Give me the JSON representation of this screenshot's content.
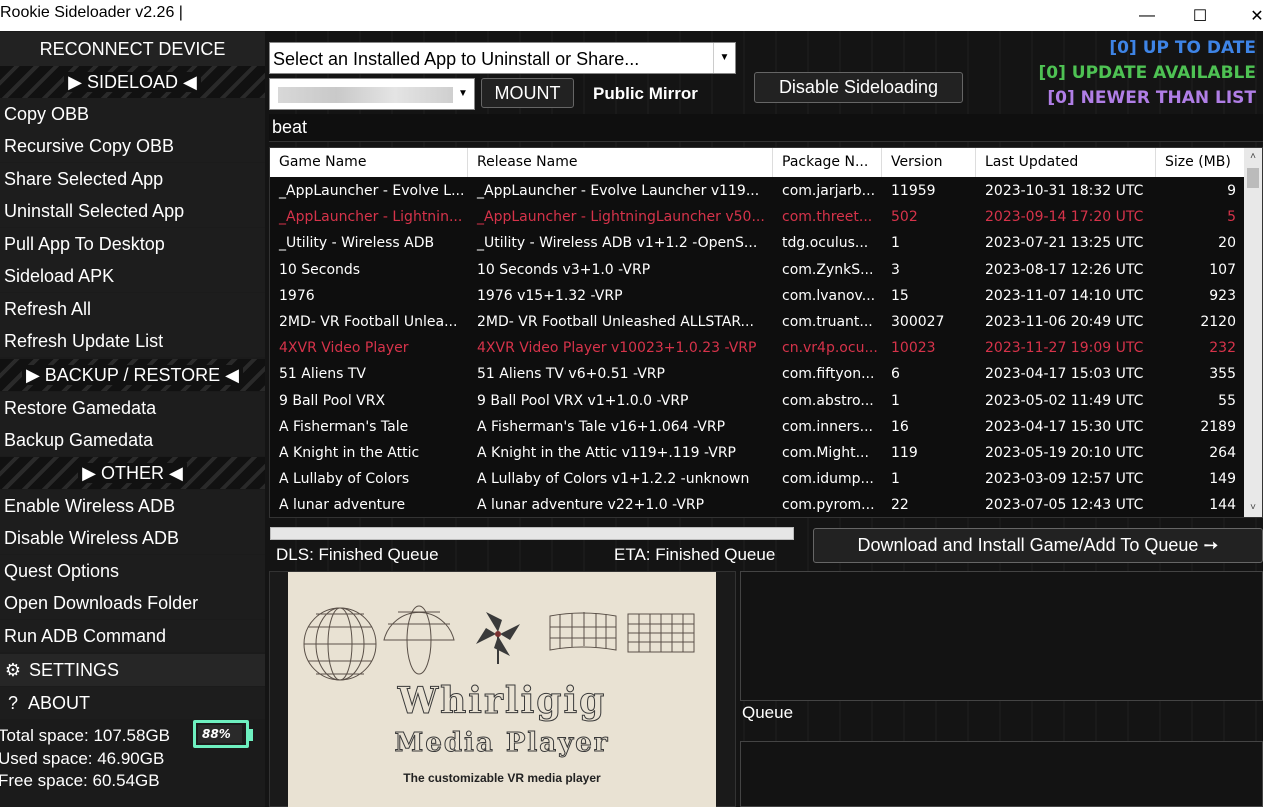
{
  "window": {
    "title": "Rookie Sideloader v2.26 |",
    "minimize_glyph": "—",
    "maximize_glyph": "☐",
    "close_glyph": "✕"
  },
  "sidebar": {
    "reconnect": "RECONNECT DEVICE",
    "sideload_header": "▶ SIDELOAD ◀",
    "sideload_items": [
      "Copy OBB",
      "Recursive Copy OBB",
      "Share Selected App",
      "Uninstall Selected App",
      "Pull App To Desktop",
      "Sideload APK",
      "Refresh All",
      "Refresh Update List"
    ],
    "backup_header": "▶ BACKUP / RESTORE ◀",
    "backup_items": [
      "Restore Gamedata",
      "Backup Gamedata"
    ],
    "other_header": "▶ OTHER ◀",
    "other_items": [
      "Enable  Wireless ADB",
      "Disable Wireless ADB",
      "Quest Options",
      "Open Downloads Folder",
      "Run ADB Command"
    ],
    "settings": "SETTINGS",
    "settings_icon": "⚙",
    "about": "ABOUT",
    "about_icon": "?",
    "storage": {
      "total": "Total space: 107.58GB",
      "used": "Used space: 46.90GB",
      "free": "Free space: 60.54GB",
      "battery": "88%",
      "battery_level": 0.88,
      "battery_color": "#6ef0c0"
    }
  },
  "toolbar": {
    "app_select_value": "Select an Installed App to Uninstall or Share...",
    "mount_label": "MOUNT",
    "mirror_label": "Public Mirror",
    "disable_sideloading_label": "Disable Sideloading",
    "dropdown_arrow": "▼"
  },
  "status": {
    "up_to_date": "[0] UP TO DATE",
    "update_available": "[0] UPDATE AVAILABLE",
    "newer_than_list": "[0] NEWER THAN LIST",
    "colors": {
      "up_to_date": "#3e84e6",
      "update_available": "#4ec253",
      "newer_than_list": "#b07ee6"
    }
  },
  "search": {
    "value": "beat"
  },
  "table": {
    "columns": [
      "Game Name",
      "Release Name",
      "Package N...",
      "Version",
      "Last Updated",
      "Size (MB)"
    ],
    "highlight_color": "#d6334a",
    "rows": [
      {
        "name": "_AppLauncher - Evolve L...",
        "release": "_AppLauncher - Evolve Launcher v119...",
        "package": "com.jarjarb...",
        "version": "11959",
        "updated": "2023-10-31 18:32 UTC",
        "size": "9",
        "highlight": false
      },
      {
        "name": "_AppLauncher - Lightnin...",
        "release": "_AppLauncher - LightningLauncher v50...",
        "package": "com.threet...",
        "version": "502",
        "updated": "2023-09-14 17:20 UTC",
        "size": "5",
        "highlight": true
      },
      {
        "name": "_Utility - Wireless ADB",
        "release": "_Utility - Wireless ADB v1+1.2 -OpenS...",
        "package": "tdg.oculus...",
        "version": "1",
        "updated": "2023-07-21 13:25 UTC",
        "size": "20",
        "highlight": false
      },
      {
        "name": "10 Seconds",
        "release": "10 Seconds v3+1.0 -VRP",
        "package": "com.ZynkS...",
        "version": "3",
        "updated": "2023-08-17 12:26 UTC",
        "size": "107",
        "highlight": false
      },
      {
        "name": "1976",
        "release": "1976 v15+1.32 -VRP",
        "package": "com.lvanov...",
        "version": "15",
        "updated": "2023-11-07 14:10 UTC",
        "size": "923",
        "highlight": false
      },
      {
        "name": "2MD- VR Football Unlea...",
        "release": "2MD- VR Football Unleashed ALLSTAR...",
        "package": "com.truant...",
        "version": "300027",
        "updated": "2023-11-06 20:49 UTC",
        "size": "2120",
        "highlight": false
      },
      {
        "name": "4XVR Video Player",
        "release": "4XVR Video Player v10023+1.0.23 -VRP",
        "package": "cn.vr4p.ocu...",
        "version": "10023",
        "updated": "2023-11-27 19:09 UTC",
        "size": "232",
        "highlight": true
      },
      {
        "name": "51 Aliens TV",
        "release": "51 Aliens TV v6+0.51 -VRP",
        "package": "com.fiftyon...",
        "version": "6",
        "updated": "2023-04-17 15:03 UTC",
        "size": "355",
        "highlight": false
      },
      {
        "name": "9 Ball Pool VRX",
        "release": "9 Ball Pool VRX v1+1.0.0 -VRP",
        "package": "com.abstro...",
        "version": "1",
        "updated": "2023-05-02 11:49 UTC",
        "size": "55",
        "highlight": false
      },
      {
        "name": "A Fisherman's Tale",
        "release": "A Fisherman's Tale v16+1.064 -VRP",
        "package": "com.inners...",
        "version": "16",
        "updated": "2023-04-17 15:30 UTC",
        "size": "2189",
        "highlight": false
      },
      {
        "name": "A Knight in the Attic",
        "release": "A Knight in the Attic v119+.119 -VRP",
        "package": "com.Might...",
        "version": "119",
        "updated": "2023-05-19 20:10 UTC",
        "size": "264",
        "highlight": false
      },
      {
        "name": "A Lullaby of Colors",
        "release": "A Lullaby of Colors v1+1.2.2 -unknown",
        "package": "com.idump...",
        "version": "1",
        "updated": "2023-03-09 12:57 UTC",
        "size": "149",
        "highlight": false
      },
      {
        "name": "A lunar adventure",
        "release": "A lunar adventure v22+1.0 -VRP",
        "package": "com.pyrom...",
        "version": "22",
        "updated": "2023-07-05 12:43 UTC",
        "size": "144",
        "highlight": false
      }
    ],
    "scroll_up": "˄",
    "scroll_down": "˅"
  },
  "download": {
    "dls_label": "DLS: Finished Queue",
    "eta_label": "ETA: Finished Queue",
    "button_label": "Download and Install Game/Add To Queue ➙",
    "progress": 0
  },
  "preview": {
    "title_line1": "Whirligig",
    "title_line2": "Media Player",
    "tagline": "The customizable VR media player"
  },
  "queue": {
    "label": "Queue"
  }
}
